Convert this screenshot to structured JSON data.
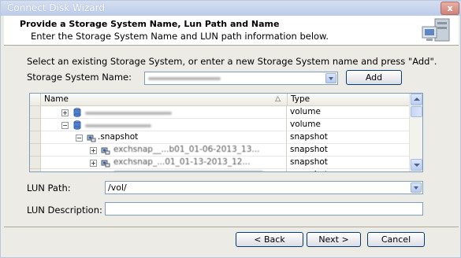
{
  "window": {
    "title": "Connect Disk Wizard",
    "close_label": "x"
  },
  "header": {
    "title": "Provide a Storage System Name, Lun Path and Name",
    "subtitle": "Enter the Storage System Name and LUN path information below."
  },
  "prompt": "Select an existing Storage System, or enter a new Storage System name and press \"Add\".",
  "storage_system": {
    "label": "Storage System Name:",
    "value": "",
    "add_label": "Add"
  },
  "tree": {
    "columns": [
      "Name",
      "Type"
    ],
    "sort_indicator": "△",
    "rows": [
      {
        "type": "volume",
        "icon": "volume-icon"
      },
      {
        "type": "volume",
        "icon": "volume-icon"
      },
      {
        "name": ".snapshot",
        "type": "snapshot",
        "icon": "snapshot-folder-icon"
      },
      {
        "name": "exchsnap__...b01_01-06-2013_13...",
        "type": "snapshot",
        "icon": "snapshot-icon"
      },
      {
        "name": "exchsnap_...01_01-13-2013_12...",
        "type": "snapshot",
        "icon": "snapshot-icon"
      },
      {
        "type": "snapshot",
        "icon": "snapshot-icon"
      }
    ]
  },
  "lun_path": {
    "label": "LUN Path:",
    "value": "/vol/"
  },
  "lun_description": {
    "label": "LUN Description:",
    "value": ""
  },
  "footer": {
    "back_label": "< Back",
    "next_label": "Next >",
    "cancel_label": "Cancel"
  }
}
